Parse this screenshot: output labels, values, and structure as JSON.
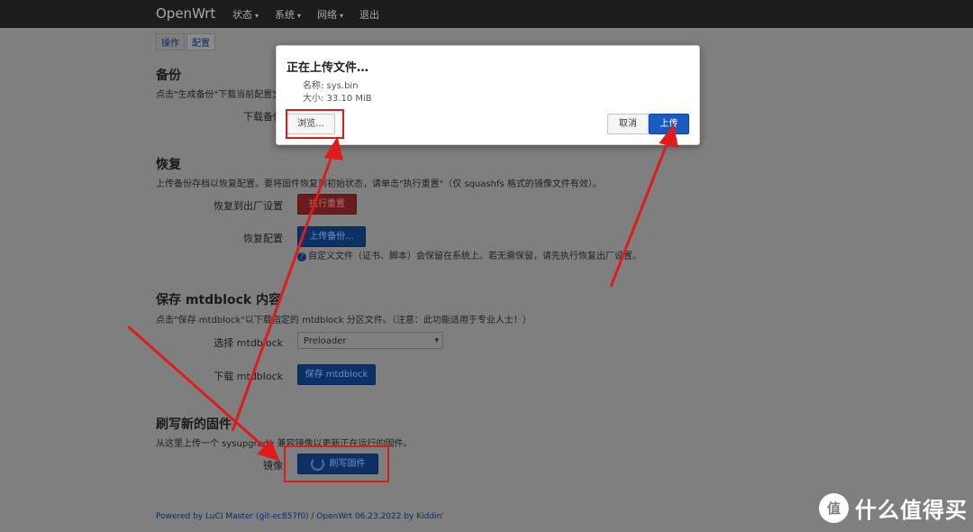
{
  "topbar": {
    "brand": "OpenWrt",
    "nav": [
      {
        "label": "状态",
        "has_dropdown": true
      },
      {
        "label": "系统",
        "has_dropdown": true
      },
      {
        "label": "网络",
        "has_dropdown": true
      },
      {
        "label": "退出",
        "has_dropdown": false
      }
    ]
  },
  "tabs": [
    {
      "label": "操作",
      "active": true
    },
    {
      "label": "配置",
      "active": false
    }
  ],
  "backup": {
    "title": "备份",
    "desc": "点击\"生成备份\"下载当前配置文件",
    "download_label": "下载备份"
  },
  "restore": {
    "title": "恢复",
    "desc": "上传备份存档以恢复配置。要将固件恢复到初始状态，请单击\"执行重置\"（仅 squashfs 格式的镜像文件有效）。",
    "reset_label": "恢复到出厂设置",
    "reset_button": "执行重置",
    "restore_label": "恢复配置",
    "upload_button": "上传备份...",
    "help": "自定义文件（证书、脚本）会保留在系统上。若无需保留，请先执行恢复出厂设置。"
  },
  "mtdblock": {
    "title": "保存 mtdblock 内容",
    "desc": "点击\"保存 mtdblock\"以下载指定的 mtdblock 分区文件。（注意：此功能适用于专业人士！）",
    "select_label": "选择 mtdblock",
    "select_value": "Preloader",
    "download_label": "下载 mtdblock",
    "save_button": "保存 mtdblock"
  },
  "flash": {
    "title": "刷写新的固件",
    "desc": "从这里上传一个 sysupgrade 兼容镜像以更新正在运行的固件。",
    "image_label": "镜像",
    "flash_button": "刷写固件"
  },
  "footer": {
    "powered": "Powered by LuCI Master (git-ec857f0)",
    "sep": " / ",
    "version": "OpenWrt 06.23.2022 by Kiddin'"
  },
  "modal": {
    "title": "正在上传文件…",
    "name_line": "名称: sys.bin",
    "size_line": "大小: 33.10 MiB",
    "browse_button": "浏览...",
    "cancel_button": "取消",
    "upload_button": "上传"
  },
  "watermark": {
    "logo": "值",
    "text": "什么值得买"
  },
  "colors": {
    "annotation_red": "#e01b1b",
    "primary_blue": "#1b5bc1",
    "danger_red": "#6b1b1b"
  }
}
